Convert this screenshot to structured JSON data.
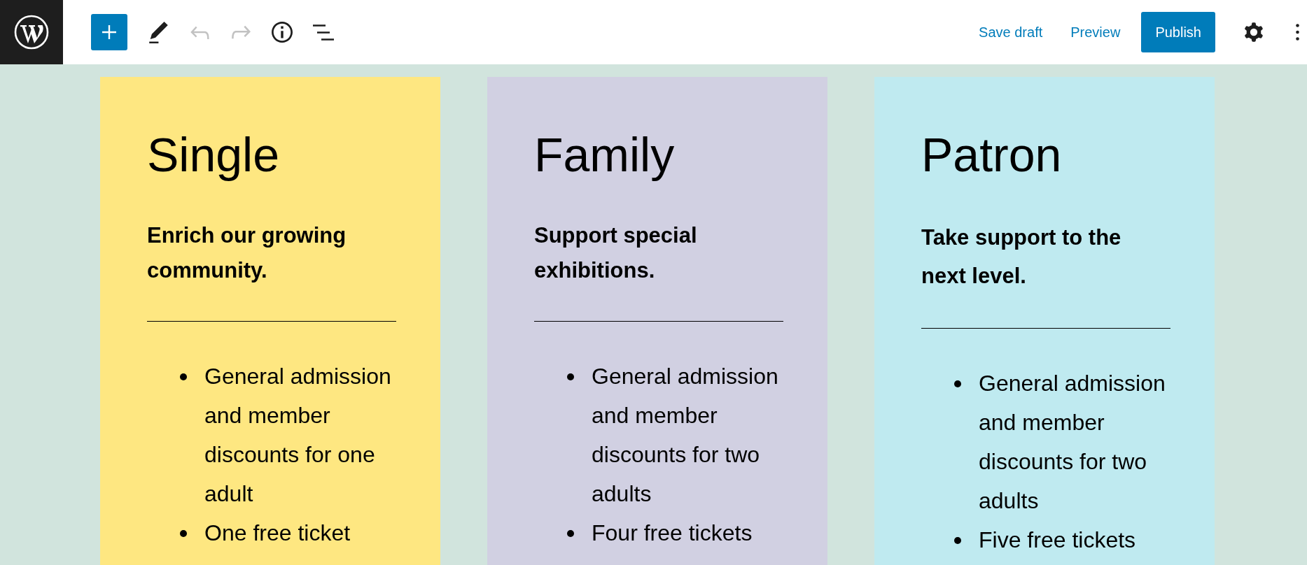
{
  "toolbar": {
    "tools": [
      {
        "kind": "inserter",
        "disabled": false
      },
      {
        "kind": "edit",
        "disabled": false
      },
      {
        "kind": "undo",
        "disabled": true
      },
      {
        "kind": "redo",
        "disabled": true
      },
      {
        "kind": "info",
        "disabled": false
      },
      {
        "kind": "outline",
        "disabled": false
      }
    ]
  },
  "actions": {
    "save_draft": "Save draft",
    "preview": "Preview",
    "publish": "Publish"
  },
  "cards": [
    {
      "title": "Single",
      "color": "#fee781",
      "tagline": "Enrich our growing community.",
      "benefits": [
        "General admission and member discounts for one adult",
        "One free ticket"
      ]
    },
    {
      "title": "Family",
      "color": "#d1d0e2",
      "tagline": "Support special exhibitions.",
      "benefits": [
        "General admission and member discounts for two adults",
        "Four free tickets"
      ]
    },
    {
      "title": "Patron",
      "color": "#bfeaf0",
      "tagline": "Take support to the next level.",
      "benefits": [
        "General admission and member discounts for two adults",
        "Five free tickets"
      ]
    }
  ]
}
